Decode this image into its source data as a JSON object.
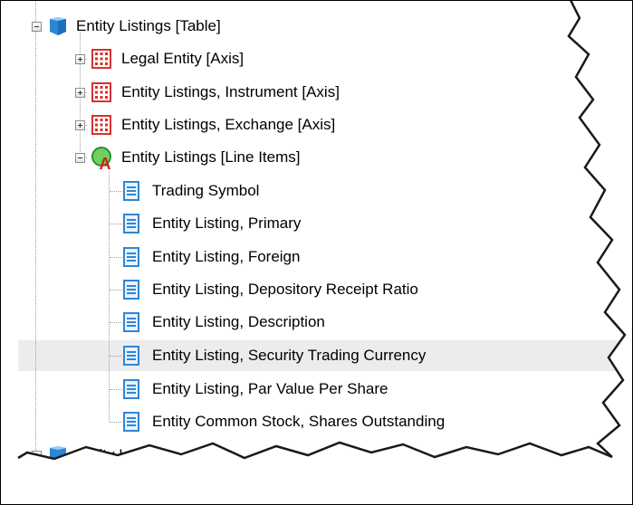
{
  "tree": {
    "table": {
      "label": "Entity Listings [Table]",
      "icon": "cube-icon"
    },
    "axes": [
      {
        "label": "Legal Entity [Axis]",
        "icon": "grid-icon"
      },
      {
        "label": "Entity Listings, Instrument [Axis]",
        "icon": "grid-icon"
      },
      {
        "label": "Entity Listings, Exchange [Axis]",
        "icon": "grid-icon"
      }
    ],
    "line_items": {
      "label": "Entity Listings [Line Items]",
      "icon": "abstract-icon"
    },
    "elements": [
      {
        "label": "Trading Symbol"
      },
      {
        "label": "Entity Listing, Primary"
      },
      {
        "label": "Entity Listing, Foreign"
      },
      {
        "label": "Entity Listing, Depository Receipt Ratio"
      },
      {
        "label": "Entity Listing, Description"
      },
      {
        "label": "Entity Listing, Security Trading Currency",
        "selected": true
      },
      {
        "label": "Entity Listing, Par Value Per Share"
      },
      {
        "label": "Entity Common Stock, Shares Outstanding"
      }
    ],
    "cut_off": {
      "label": "Entity Locatio"
    }
  },
  "colors": {
    "cube_blue": "#3b8fe0",
    "grid_red": "#d9302c",
    "abstract_green": "#3aa33a",
    "abstract_red": "#cc1f1f",
    "doc_blue": "#2f86d6",
    "selection": "#ececec"
  }
}
